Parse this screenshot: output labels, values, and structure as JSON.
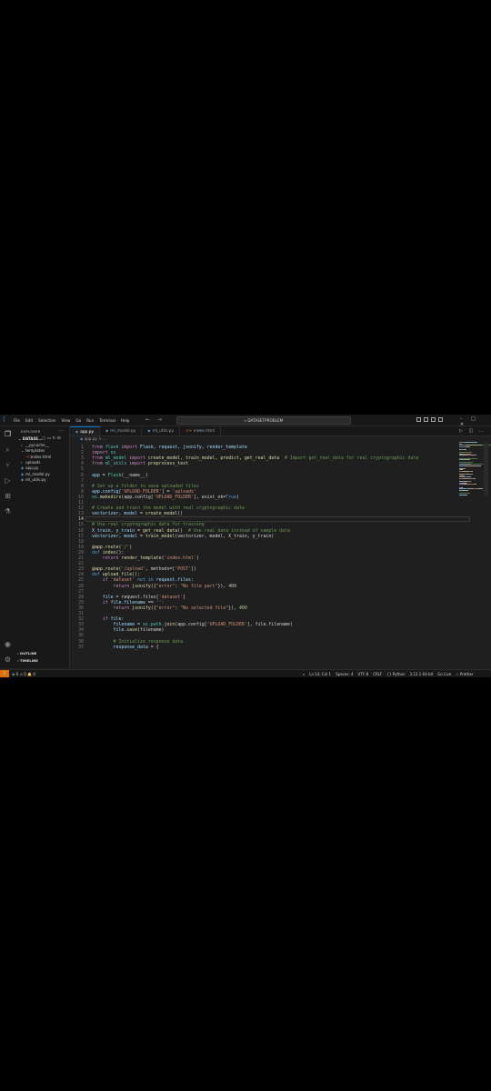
{
  "menu": {
    "items": [
      "File",
      "Edit",
      "Selection",
      "View",
      "Go",
      "Run",
      "Terminal",
      "Help"
    ],
    "search": "DATASETPROBLEM"
  },
  "sidebar": {
    "title": "EXPLORER",
    "project": "DATASE...",
    "tree": [
      {
        "label": "__pycache__",
        "type": "folder"
      },
      {
        "label": "templates",
        "type": "folder-open"
      },
      {
        "label": "index.html",
        "type": "html"
      },
      {
        "label": "uploads",
        "type": "folder"
      },
      {
        "label": "app.py",
        "type": "py"
      },
      {
        "label": "ml_model.py",
        "type": "py"
      },
      {
        "label": "ml_utils.py",
        "type": "py"
      }
    ],
    "outline": "OUTLINE",
    "timeline": "TIMELINE"
  },
  "tabs": [
    {
      "label": "app.py",
      "type": "py",
      "active": true
    },
    {
      "label": "ml_model.py",
      "type": "py",
      "active": false
    },
    {
      "label": "ml_utils.py",
      "type": "py",
      "active": false
    },
    {
      "label": "index.html",
      "type": "html",
      "active": false
    }
  ],
  "breadcrumb": "app.py > ...",
  "editor": {
    "current_line": 14,
    "lines": [
      [
        [
          "from ",
          "#c586c0"
        ],
        [
          "flask ",
          "#4ec9b0"
        ],
        [
          "import ",
          "#c586c0"
        ],
        [
          "Flask, request, jsonify, render_template",
          "#9cdcfe"
        ]
      ],
      [
        [
          "import ",
          "#c586c0"
        ],
        [
          "os",
          "#4ec9b0"
        ]
      ],
      [
        [
          "from ",
          "#c586c0"
        ],
        [
          "ml_model ",
          "#4ec9b0"
        ],
        [
          "import ",
          "#c586c0"
        ],
        [
          "create_model, train_model, predict, get_real_data  ",
          "#dcdcaa"
        ],
        [
          "# Import get_real_data for real cryptographic data",
          "#6a9955"
        ]
      ],
      [
        [
          "from ",
          "#c586c0"
        ],
        [
          "ml_utils ",
          "#4ec9b0"
        ],
        [
          "import ",
          "#c586c0"
        ],
        [
          "preprocess_text",
          "#dcdcaa"
        ]
      ],
      [],
      [
        [
          "app ",
          "#9cdcfe"
        ],
        [
          "= ",
          "#d4d4d4"
        ],
        [
          "Flask",
          "#4ec9b0"
        ],
        [
          "(__name__)",
          "#d4d4d4"
        ]
      ],
      [],
      [
        [
          "# Set up a folder to save uploaded files",
          "#6a9955"
        ]
      ],
      [
        [
          "app.config[",
          "#9cdcfe"
        ],
        [
          "'UPLOAD_FOLDER'",
          "#ce9178"
        ],
        [
          "] = ",
          "#d4d4d4"
        ],
        [
          "'uploads'",
          "#ce9178"
        ]
      ],
      [
        [
          "os.",
          "#4ec9b0"
        ],
        [
          "makedirs",
          "#dcdcaa"
        ],
        [
          "(app.config[",
          "#d4d4d4"
        ],
        [
          "'UPLOAD_FOLDER'",
          "#ce9178"
        ],
        [
          "], exist_ok=",
          "#d4d4d4"
        ],
        [
          "True",
          "#569cd6"
        ],
        [
          ")",
          "#d4d4d4"
        ]
      ],
      [],
      [
        [
          "# Create and train the model with real cryptographic data",
          "#6a9955"
        ]
      ],
      [
        [
          "vectorizer, model ",
          "#9cdcfe"
        ],
        [
          "= ",
          "#d4d4d4"
        ],
        [
          "create_model",
          "#dcdcaa"
        ],
        [
          "()",
          "#d4d4d4"
        ]
      ],
      [],
      [
        [
          "# Use real cryptographic data for training",
          "#6a9955"
        ]
      ],
      [
        [
          "X_train, y_train ",
          "#9cdcfe"
        ],
        [
          "= ",
          "#d4d4d4"
        ],
        [
          "get_real_data",
          "#dcdcaa"
        ],
        [
          "()  ",
          "#d4d4d4"
        ],
        [
          "# Use real data instead of sample data",
          "#6a9955"
        ]
      ],
      [
        [
          "vectorizer, model ",
          "#9cdcfe"
        ],
        [
          "= ",
          "#d4d4d4"
        ],
        [
          "train_model",
          "#dcdcaa"
        ],
        [
          "(vectorizer, model, X_train, y_train)",
          "#d4d4d4"
        ]
      ],
      [],
      [
        [
          "@app.route",
          "#dcdcaa"
        ],
        [
          "(",
          "#d4d4d4"
        ],
        [
          "'/'",
          "#ce9178"
        ],
        [
          ")",
          "#d4d4d4"
        ]
      ],
      [
        [
          "def ",
          "#569cd6"
        ],
        [
          "index",
          "#dcdcaa"
        ],
        [
          "():",
          "#d4d4d4"
        ]
      ],
      [
        [
          "    return ",
          "#c586c0"
        ],
        [
          "render_template",
          "#dcdcaa"
        ],
        [
          "(",
          "#d4d4d4"
        ],
        [
          "'index.html'",
          "#ce9178"
        ],
        [
          ")",
          "#d4d4d4"
        ]
      ],
      [],
      [
        [
          "@app.route",
          "#dcdcaa"
        ],
        [
          "(",
          "#d4d4d4"
        ],
        [
          "'/upload'",
          "#ce9178"
        ],
        [
          ", methods=[",
          "#d4d4d4"
        ],
        [
          "'POST'",
          "#ce9178"
        ],
        [
          "])",
          "#d4d4d4"
        ]
      ],
      [
        [
          "def ",
          "#569cd6"
        ],
        [
          "upload_file",
          "#dcdcaa"
        ],
        [
          "():",
          "#d4d4d4"
        ]
      ],
      [
        [
          "    if ",
          "#c586c0"
        ],
        [
          "'dataset' ",
          "#ce9178"
        ],
        [
          "not in ",
          "#569cd6"
        ],
        [
          "request.files:",
          "#9cdcfe"
        ]
      ],
      [
        [
          "        return ",
          "#c586c0"
        ],
        [
          "jsonify",
          "#dcdcaa"
        ],
        [
          "({",
          "#d4d4d4"
        ],
        [
          "\"error\"",
          "#ce9178"
        ],
        [
          ": ",
          "#d4d4d4"
        ],
        [
          "\"No file part\"",
          "#ce9178"
        ],
        [
          "}), ",
          "#d4d4d4"
        ],
        [
          "400",
          "#b5cea8"
        ]
      ],
      [],
      [
        [
          "    file ",
          "#9cdcfe"
        ],
        [
          "= request.files[",
          "#d4d4d4"
        ],
        [
          "'dataset'",
          "#ce9178"
        ],
        [
          "]",
          "#d4d4d4"
        ]
      ],
      [
        [
          "    if ",
          "#c586c0"
        ],
        [
          "file.filename ",
          "#9cdcfe"
        ],
        [
          "== ",
          "#d4d4d4"
        ],
        [
          "'':",
          "#ce9178"
        ]
      ],
      [
        [
          "        return ",
          "#c586c0"
        ],
        [
          "jsonify",
          "#dcdcaa"
        ],
        [
          "({",
          "#d4d4d4"
        ],
        [
          "\"error\"",
          "#ce9178"
        ],
        [
          ": ",
          "#d4d4d4"
        ],
        [
          "\"No selected file\"",
          "#ce9178"
        ],
        [
          "}), ",
          "#d4d4d4"
        ],
        [
          "400",
          "#b5cea8"
        ]
      ],
      [],
      [
        [
          "    if ",
          "#c586c0"
        ],
        [
          "file:",
          "#9cdcfe"
        ]
      ],
      [
        [
          "        filename ",
          "#9cdcfe"
        ],
        [
          "= ",
          "#d4d4d4"
        ],
        [
          "os.path.",
          "#4ec9b0"
        ],
        [
          "join",
          "#dcdcaa"
        ],
        [
          "(app.config[",
          "#d4d4d4"
        ],
        [
          "'UPLOAD_FOLDER'",
          "#ce9178"
        ],
        [
          "], file.filename)",
          "#d4d4d4"
        ]
      ],
      [
        [
          "        file.",
          "#9cdcfe"
        ],
        [
          "save",
          "#dcdcaa"
        ],
        [
          "(filename)",
          "#d4d4d4"
        ]
      ],
      [],
      [
        [
          "        # Initialize response data",
          "#6a9955"
        ]
      ],
      [
        [
          "        response_data ",
          "#9cdcfe"
        ],
        [
          "= {",
          "#d4d4d4"
        ]
      ]
    ]
  },
  "statusbar": {
    "problems": "⊗ 0 ⚠ 0",
    "ports": "🔔 0",
    "position": "Ln 14, Col 1",
    "spaces": "Spaces: 4",
    "encoding": "UTF-8",
    "eol": "CRLF",
    "language": "{} Python",
    "interpreter": "3.12.1 64-bit",
    "golive": "Go Live",
    "prettier": "✓ Prettier"
  }
}
